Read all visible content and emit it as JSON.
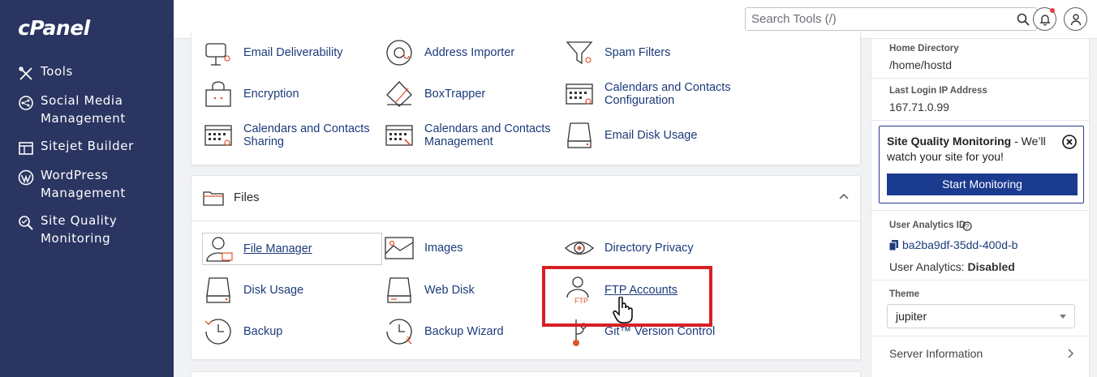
{
  "app": {
    "logo": "cPanel"
  },
  "sidebar": {
    "items": [
      {
        "label": "Tools",
        "icon": "tools-icon"
      },
      {
        "label": "Social Media\nManagement",
        "icon": "social-media-icon"
      },
      {
        "label": "Sitejet Builder",
        "icon": "sitejet-icon"
      },
      {
        "label": "WordPress\nManagement",
        "icon": "wordpress-icon"
      },
      {
        "label": "Site Quality\nMonitoring",
        "icon": "site-quality-icon"
      }
    ]
  },
  "topbar": {
    "search_placeholder": "Search Tools (/)",
    "notification_icon": "bell-icon",
    "user_icon": "user-icon"
  },
  "email": {
    "tools": [
      {
        "label": "Email Deliverability",
        "icon": "email-deliverability-icon"
      },
      {
        "label": "Address Importer",
        "icon": "address-importer-icon"
      },
      {
        "label": "Spam Filters",
        "icon": "spam-filters-icon"
      },
      {
        "label": "Encryption",
        "icon": "encryption-icon"
      },
      {
        "label": "BoxTrapper",
        "icon": "boxtrapper-icon"
      },
      {
        "label": "Calendars and Contacts\nConfiguration",
        "icon": "calendar-config-icon"
      },
      {
        "label": "Calendars and Contacts\nSharing",
        "icon": "calendar-sharing-icon"
      },
      {
        "label": "Calendars and Contacts\nManagement",
        "icon": "calendar-management-icon"
      },
      {
        "label": "Email Disk Usage",
        "icon": "email-disk-usage-icon"
      }
    ]
  },
  "files": {
    "title": "Files",
    "tools": [
      {
        "label": "File Manager",
        "icon": "file-manager-icon"
      },
      {
        "label": "Images",
        "icon": "images-icon"
      },
      {
        "label": "Directory Privacy",
        "icon": "directory-privacy-icon"
      },
      {
        "label": "Disk Usage",
        "icon": "disk-usage-icon"
      },
      {
        "label": "Web Disk",
        "icon": "web-disk-icon"
      },
      {
        "label": "FTP Accounts",
        "icon": "ftp-accounts-icon"
      },
      {
        "label": "Backup",
        "icon": "backup-icon"
      },
      {
        "label": "Backup Wizard",
        "icon": "backup-wizard-icon"
      },
      {
        "label": "Git™ Version Control",
        "icon": "git-icon"
      }
    ]
  },
  "right": {
    "home_directory_label": "Home Directory",
    "home_directory_value": "/home/hostd",
    "last_login_label": "Last Login IP Address",
    "last_login_value": "167.71.0.99",
    "sqm_title": "Site Quality Monitoring",
    "sqm_text": " - We’ll watch your site for you!",
    "sqm_button": "Start Monitoring",
    "analytics_id_label": "User Analytics ID",
    "analytics_id_value": "ba2ba9df-35dd-400d-b",
    "analytics_status_label": "User Analytics:",
    "analytics_status_value": "Disabled",
    "theme_label": "Theme",
    "theme_value": "jupiter",
    "server_info_label": "Server Information"
  },
  "colors": {
    "sidebar": "#2a3561",
    "link": "#1b3b7a",
    "accent_red": "#d81f26",
    "button": "#1b3b8f"
  }
}
